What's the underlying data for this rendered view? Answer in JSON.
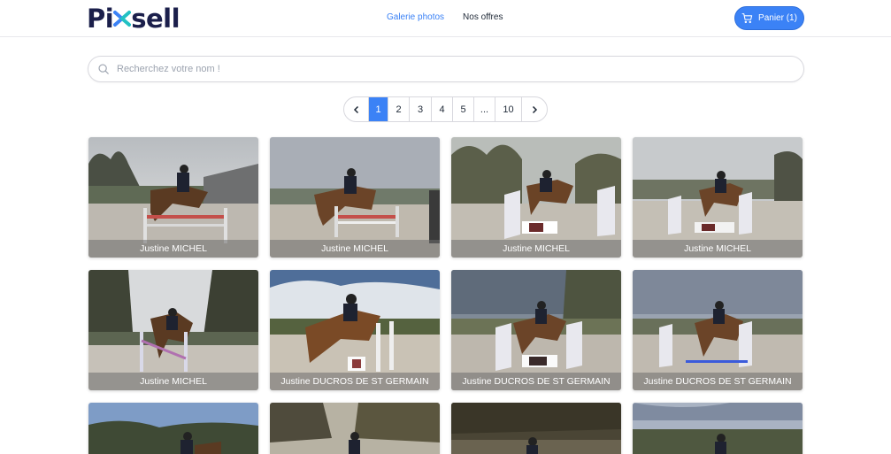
{
  "brand": {
    "logo_text_left": "Pi",
    "logo_text_right": "sell"
  },
  "nav": {
    "items": [
      {
        "label": "Galerie photos",
        "active": true
      },
      {
        "label": "Nos offres",
        "active": false
      }
    ]
  },
  "cart": {
    "label": "Panier (1)",
    "icon": "cart-icon"
  },
  "search": {
    "placeholder": "Recherchez votre nom !",
    "value": "",
    "icon": "search-icon"
  },
  "pagination": {
    "prev_icon": "chevron-left-icon",
    "next_icon": "chevron-right-icon",
    "pages": [
      "1",
      "2",
      "3",
      "4",
      "5",
      "...",
      "10"
    ],
    "current": "1"
  },
  "colors": {
    "accent": "#3b82f6",
    "brand": "#1b1f4b",
    "logo_x_blue": "#3b82f6",
    "logo_x_teal": "#22c1c3"
  },
  "photos": [
    {
      "caption": "Justine MICHEL"
    },
    {
      "caption": "Justine MICHEL"
    },
    {
      "caption": "Justine MICHEL"
    },
    {
      "caption": "Justine MICHEL"
    },
    {
      "caption": "Justine MICHEL"
    },
    {
      "caption": "Justine DUCROS DE ST GERMAIN"
    },
    {
      "caption": "Justine DUCROS DE ST GERMAIN"
    },
    {
      "caption": "Justine DUCROS DE ST GERMAIN"
    },
    {
      "caption": ""
    },
    {
      "caption": ""
    },
    {
      "caption": ""
    },
    {
      "caption": ""
    }
  ]
}
